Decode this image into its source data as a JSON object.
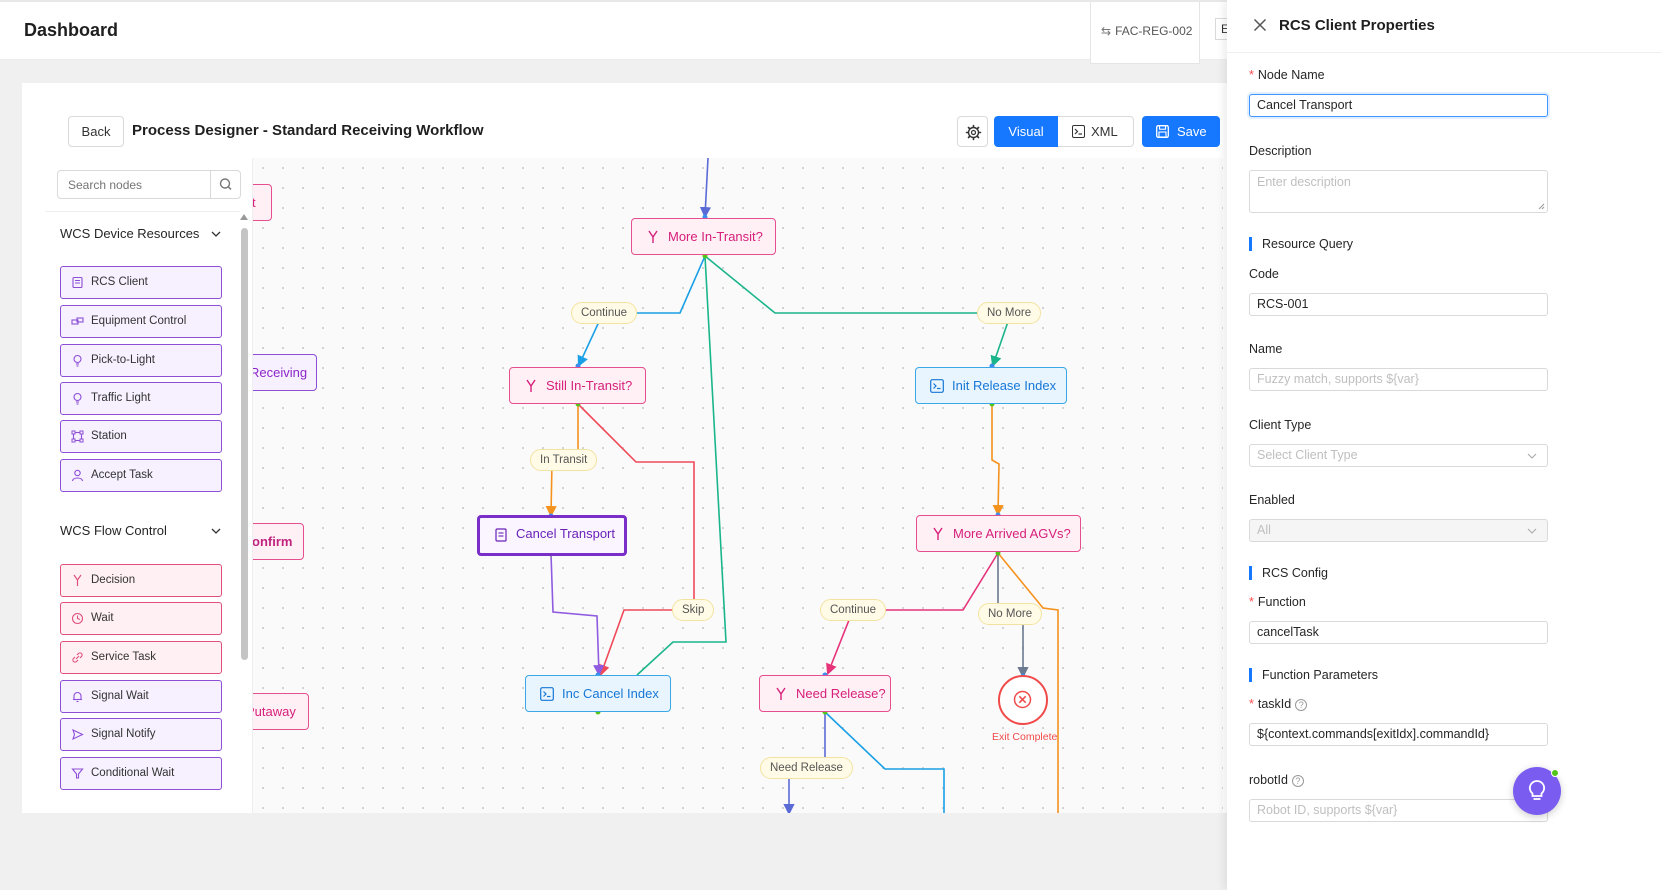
{
  "header": {
    "title": "Dashboard",
    "facility": "FAC-REG-002",
    "extra_tab": "E"
  },
  "toolbar": {
    "back_label": "Back",
    "designer_title": "Process Designer - Standard Receiving Workflow",
    "visual_label": "Visual",
    "xml_label": "XML",
    "save_label": "Save"
  },
  "palette": {
    "search_placeholder": "Search nodes",
    "groups": [
      {
        "title": "WCS Device Resources",
        "items": [
          "RCS Client",
          "Equipment Control",
          "Pick-to-Light",
          "Traffic Light",
          "Station",
          "Accept Task"
        ]
      },
      {
        "title": "WCS Flow Control",
        "items": [
          "Decision",
          "Wait",
          "Service Task",
          "Signal Wait",
          "Signal Notify",
          "Conditional Wait"
        ]
      }
    ]
  },
  "canvas": {
    "nodes": {
      "partial_t": "t",
      "partial_receiving": "Receiving",
      "partial_confirm": "onfirm",
      "partial_putaway": "Putaway",
      "more_in_transit": "More In-Transit?",
      "still_in_transit": "Still In-Transit?",
      "init_release_index": "Init Release Index",
      "cancel_transport": "Cancel Transport",
      "more_arrived_agvs": "More Arrived AGVs?",
      "inc_cancel_index": "Inc Cancel Index",
      "need_release": "Need Release?",
      "exit_complete": "Exit Complete"
    },
    "edge_labels": {
      "continue_1": "Continue",
      "no_more_1": "No More",
      "in_transit": "In Transit",
      "skip": "Skip",
      "continue_2": "Continue",
      "no_more_2": "No More",
      "need_release": "Need Release"
    },
    "colors": {
      "blue": "#1aa0e6",
      "green": "#1ab58a",
      "orange": "#f5921e",
      "red": "#f04a5a",
      "purple": "#8f5be0",
      "navy": "#5b6bd6",
      "slate": "#6b7a90"
    }
  },
  "properties": {
    "title": "RCS Client Properties",
    "node_name_label": "Node Name",
    "node_name_value": "Cancel Transport",
    "description_label": "Description",
    "description_placeholder": "Enter description",
    "resource_query_section": "Resource Query",
    "code_label": "Code",
    "code_value": "RCS-001",
    "name_label": "Name",
    "name_placeholder": "Fuzzy match, supports ${var}",
    "client_type_label": "Client Type",
    "client_type_placeholder": "Select Client Type",
    "enabled_label": "Enabled",
    "enabled_value": "All",
    "rcs_config_section": "RCS Config",
    "function_label": "Function",
    "function_value": "cancelTask",
    "function_params_section": "Function Parameters",
    "task_id_label": "taskId",
    "task_id_value": "${context.commands[exitIdx].commandId}",
    "robot_id_label": "robotId",
    "robot_id_placeholder": "Robot ID, supports ${var}"
  }
}
